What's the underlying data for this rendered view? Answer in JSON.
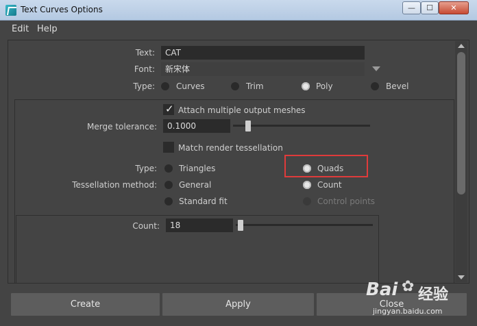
{
  "window": {
    "title": "Text Curves Options"
  },
  "menu": {
    "items": [
      "Edit",
      "Help"
    ]
  },
  "form": {
    "text_label": "Text:",
    "text_value": "CAT",
    "font_label": "Font:",
    "font_value": "新宋体",
    "type_label": "Type:",
    "type_options": [
      "Curves",
      "Trim",
      "Poly",
      "Bevel"
    ],
    "type_selected": "Poly",
    "attach_label": "Attach multiple output meshes",
    "attach_checked": true,
    "merge_label": "Merge tolerance:",
    "merge_value": "0.1000",
    "match_label": "Match render tessellation",
    "match_checked": false,
    "poly_type_label": "Type:",
    "poly_type_options": [
      "Triangles",
      "Quads"
    ],
    "poly_type_selected": "Quads",
    "tess_label": "Tessellation method:",
    "tess_options": [
      "General",
      "Count",
      "Standard fit",
      "Control points"
    ],
    "tess_selected": "Count",
    "count_label": "Count:",
    "count_value": "18"
  },
  "buttons": {
    "create": "Create",
    "apply": "Apply",
    "close": "Close"
  },
  "watermark": {
    "brand": "Bai",
    "brand2": "经验",
    "url": "jingyan.baidu.com"
  },
  "colors": {
    "highlight": "#e03b3b",
    "titlebar": "#b4c9e2",
    "panel": "#444444"
  }
}
